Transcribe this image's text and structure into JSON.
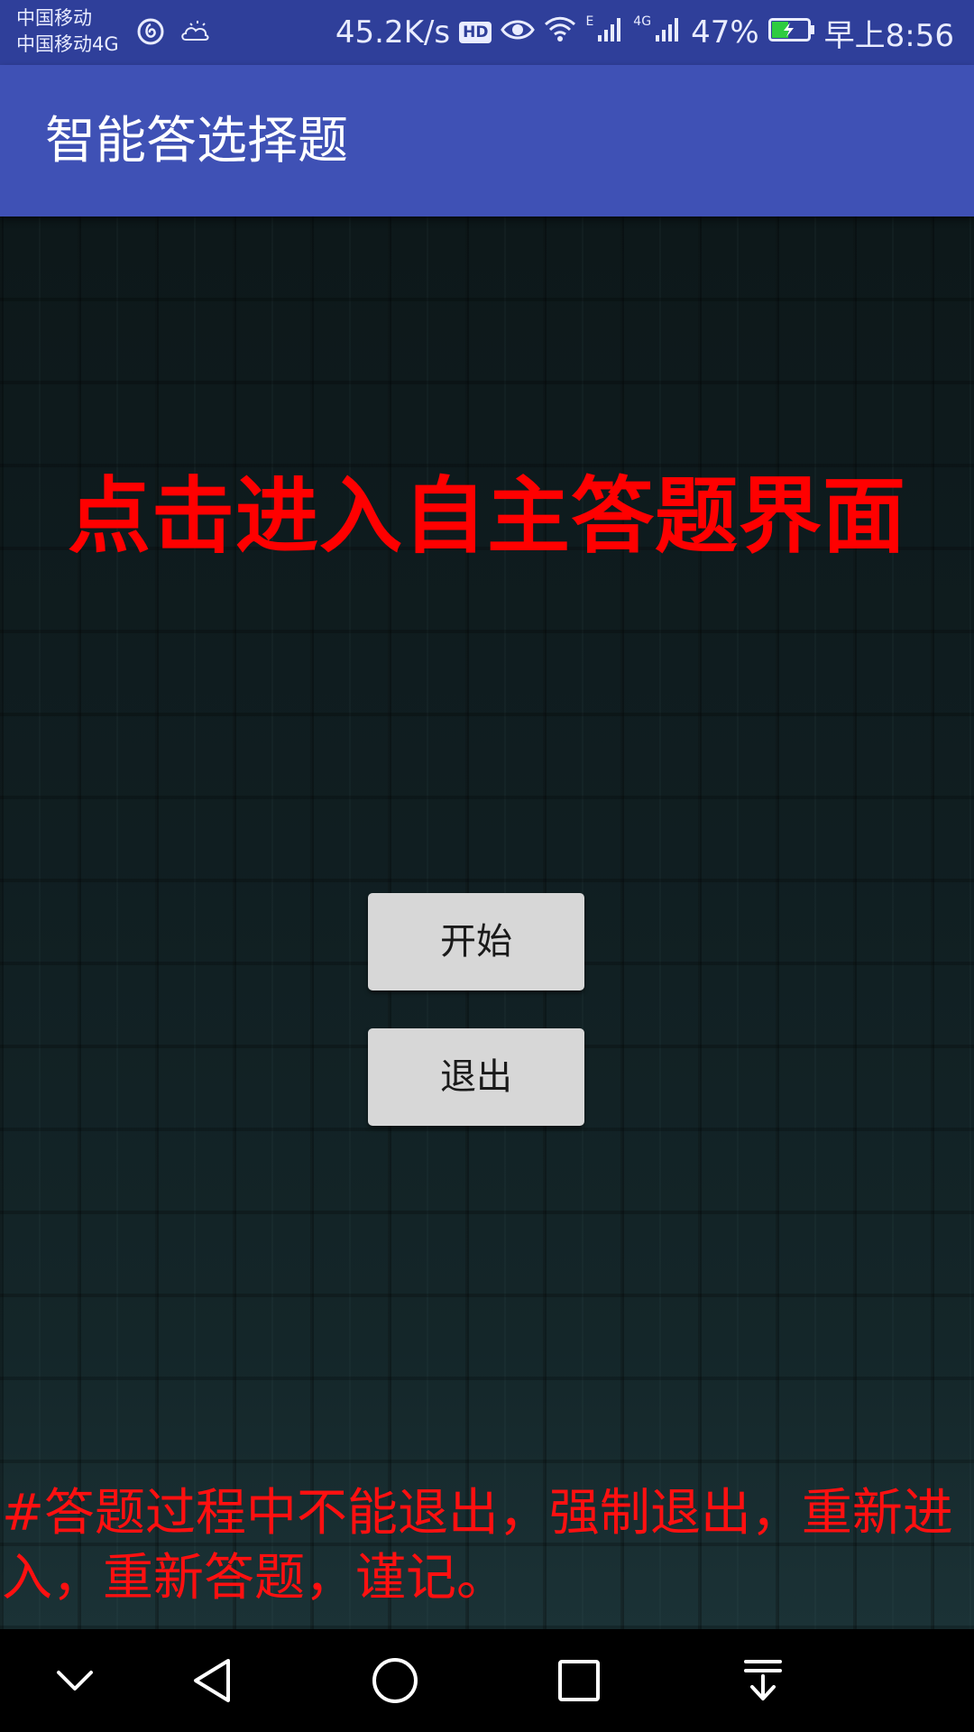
{
  "status_bar": {
    "carrier_1": "中国移动",
    "carrier_2": "中国移动4G",
    "icons_left": [
      "netease-cloud-music-icon",
      "weather-cloudy-icon"
    ],
    "net_speed": "45.2K/s",
    "hd_badge": "HD",
    "signal_1_label": "E",
    "signal_2_label": "4G",
    "battery_percent": "47%",
    "time": "早上8:56",
    "battery_level": 0.47,
    "battery_color": "#2ecc40"
  },
  "app_bar": {
    "title": "智能答选择题",
    "color": "#3f51b5"
  },
  "main": {
    "headline": "点击进入自主答题界面",
    "headline_color": "#ff0000",
    "start_button_label": "开始",
    "exit_button_label": "退出",
    "notice": "#答题过程中不能退出，强制退出，重新进入，重新答题，谨记。"
  },
  "nav_bar": {
    "buttons": [
      "hide-nav-chevron-icon",
      "back-triangle-icon",
      "home-circle-icon",
      "recents-square-icon",
      "notification-pull-down-icon"
    ]
  }
}
